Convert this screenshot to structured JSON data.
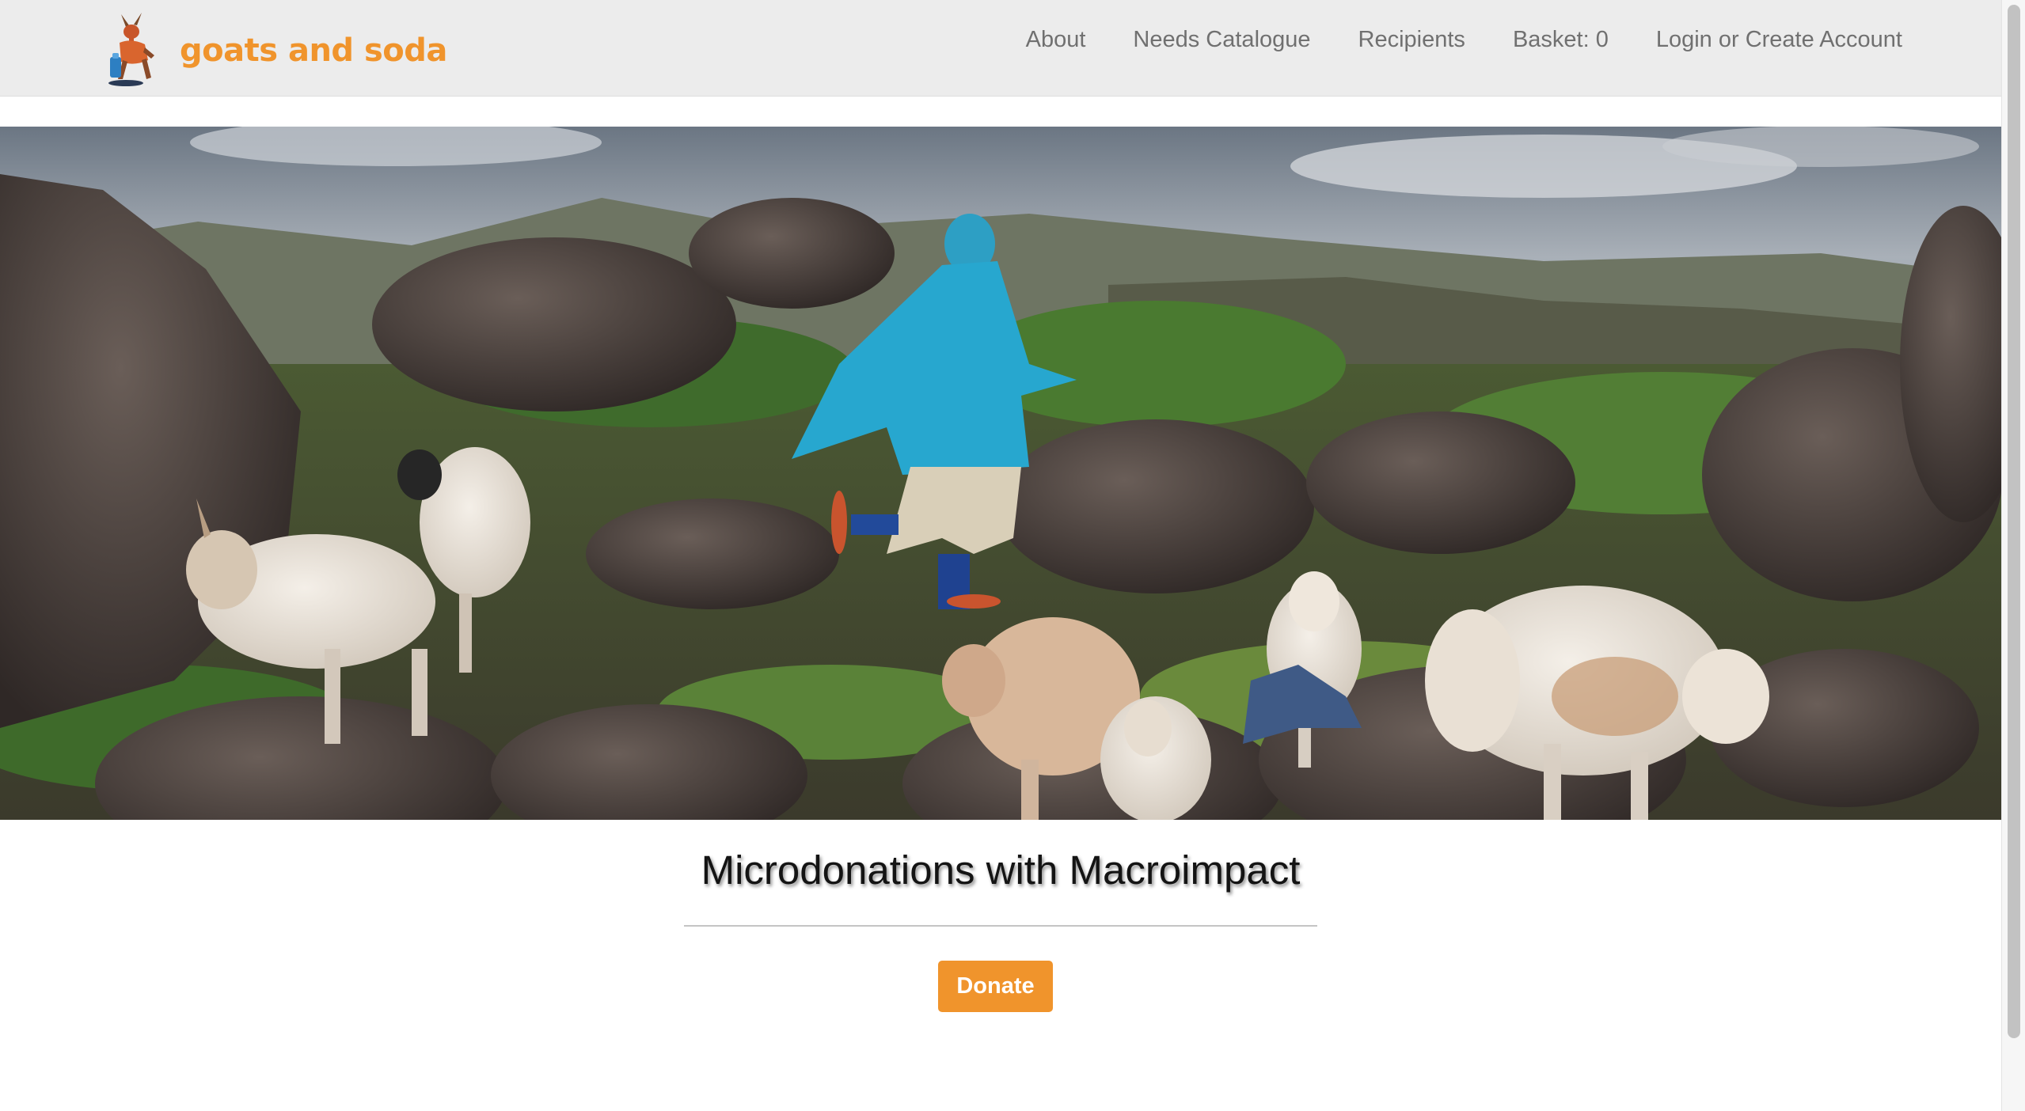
{
  "header": {
    "brand_name": "goats and soda",
    "nav": [
      {
        "label": "About"
      },
      {
        "label": "Needs Catalogue"
      },
      {
        "label": "Recipients"
      },
      {
        "label": "Basket: 0"
      },
      {
        "label": "Login or Create Account"
      }
    ]
  },
  "hero": {
    "image_icon": "hero-photo-girl-with-goats"
  },
  "main": {
    "headline": "Microdonations with Macroimpact",
    "donate_label": "Donate"
  },
  "colors": {
    "brand": "#f0942c",
    "header_bg": "#ececec",
    "nav_text": "#707070",
    "button_text": "#ffffff"
  }
}
